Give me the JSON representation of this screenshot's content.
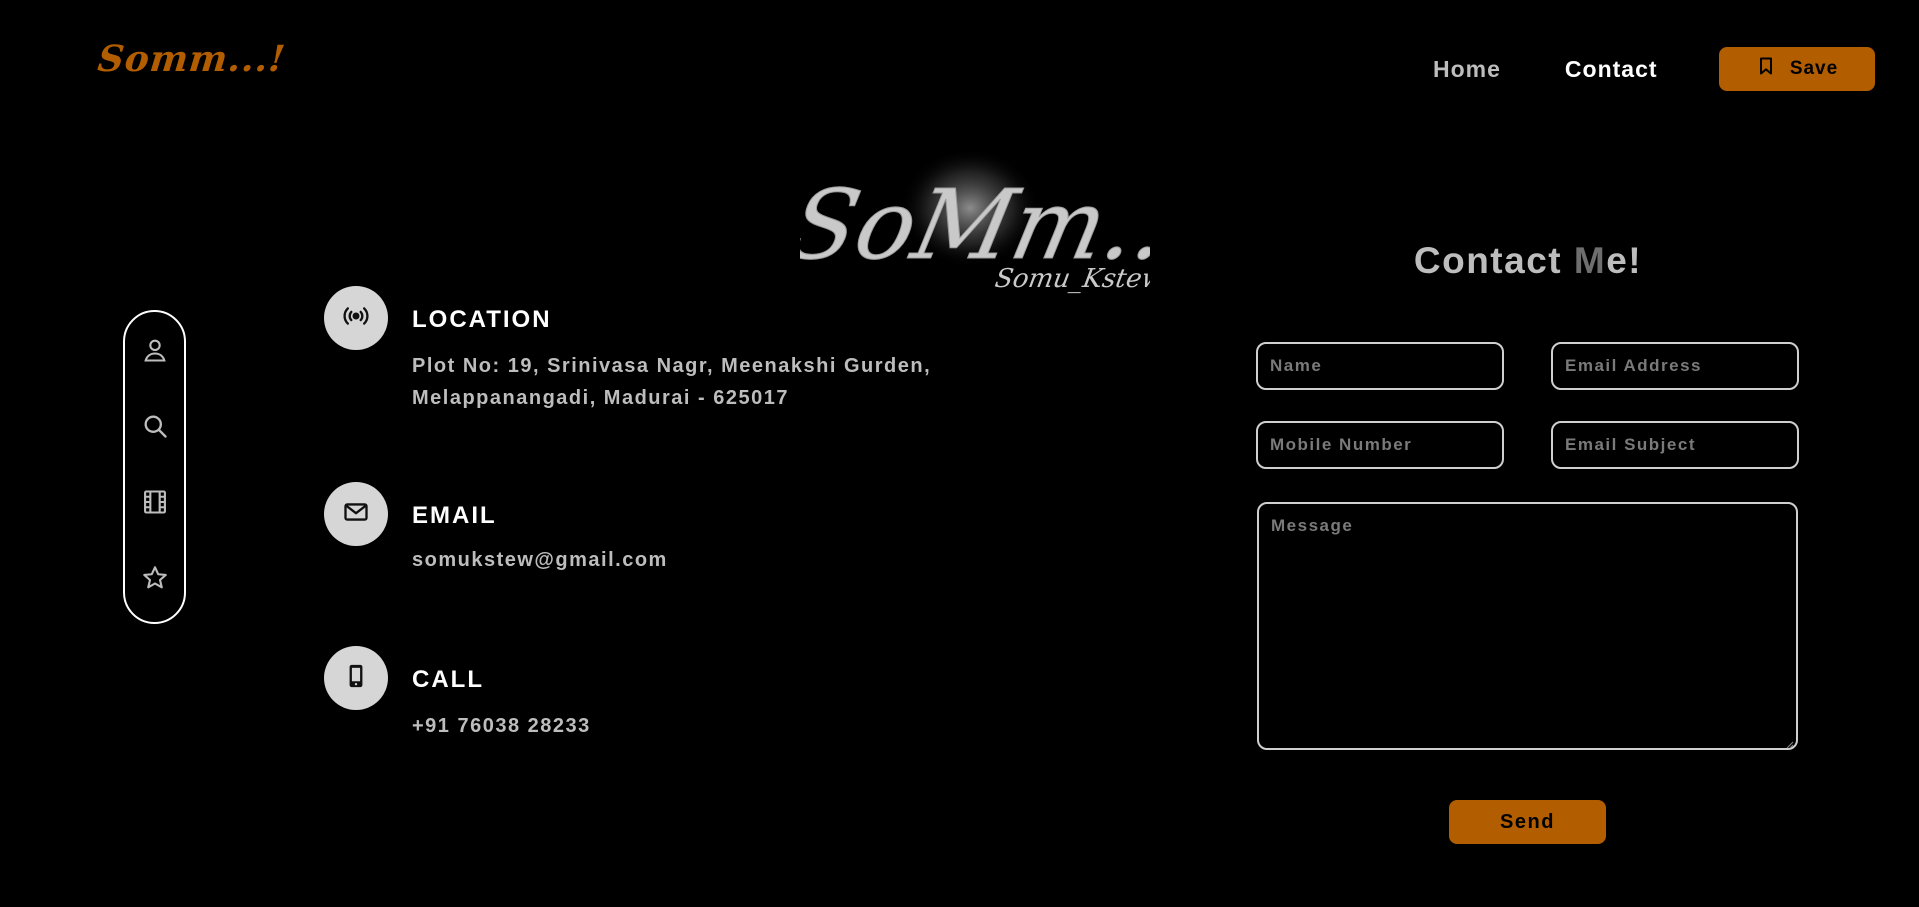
{
  "header": {
    "brand": "Somm...!",
    "nav": [
      {
        "label": "Home",
        "active": false
      },
      {
        "label": "Contact",
        "active": true
      }
    ],
    "save_label": "Save",
    "save_icon": "bookmark-icon"
  },
  "logo": {
    "script_text": "SoMm...!",
    "subtitle": "Somu_Kstew"
  },
  "sidebar": {
    "icons": [
      "user-icon",
      "search-icon",
      "film-icon",
      "star-icon"
    ]
  },
  "contact_info": {
    "location": {
      "title": "LOCATION",
      "line1": "Plot No: 19, Srinivasa Nagr, Meenakshi Gurden,",
      "line2": "Melappanangadi, Madurai - 625017",
      "icon": "broadcast-icon"
    },
    "email": {
      "title": "EMAIL",
      "value": "somukstew@gmail.com",
      "icon": "mail-icon"
    },
    "call": {
      "title": "CALL",
      "value": "+91 76038 28233",
      "icon": "phone-icon"
    }
  },
  "form": {
    "title_main": "Contact ",
    "title_dim": "M",
    "title_end": "e!",
    "name_placeholder": "Name",
    "email_placeholder": "Email Address",
    "mobile_placeholder": "Mobile Number",
    "subject_placeholder": "Email Subject",
    "message_placeholder": "Message",
    "send_label": "Send"
  },
  "colors": {
    "background": "#000000",
    "accent": "#b25d00",
    "text_primary": "#ffffff",
    "text_secondary": "#bdbdbd"
  }
}
